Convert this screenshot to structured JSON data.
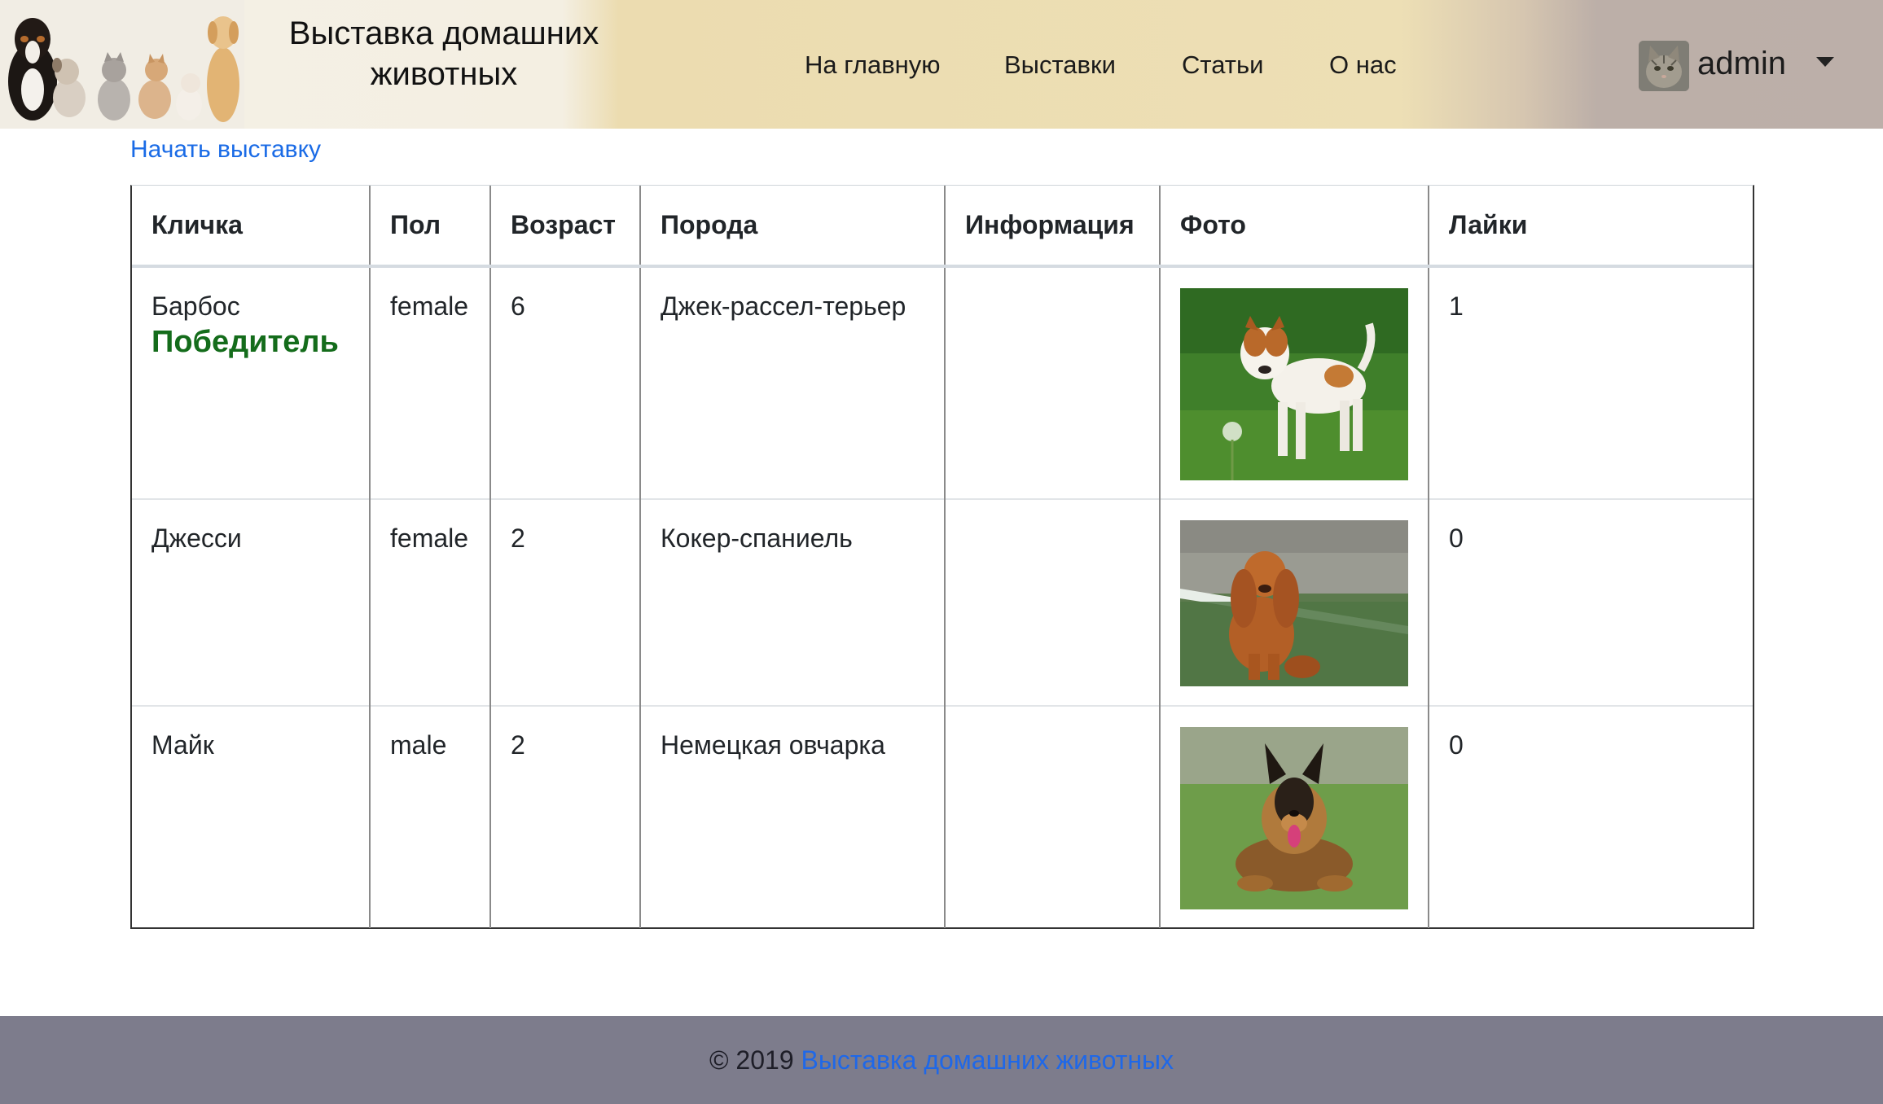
{
  "header": {
    "brand_title": "Выставка домашних животных",
    "nav": [
      {
        "label": "На главную"
      },
      {
        "label": "Выставки"
      },
      {
        "label": "Статьи"
      },
      {
        "label": "О нас"
      }
    ],
    "user": {
      "name": "admin"
    }
  },
  "main": {
    "start_link": "Начать выставку",
    "table": {
      "headers": [
        "Кличка",
        "Пол",
        "Возраст",
        "Порода",
        "Информация",
        "Фото",
        "Лайки"
      ],
      "rows": [
        {
          "name": "Барбос",
          "badge": "Победитель",
          "sex": "female",
          "age": "6",
          "breed": "Джек-рассел-терьер",
          "info": "",
          "likes": "1"
        },
        {
          "name": "Джесси",
          "badge": "",
          "sex": "female",
          "age": "2",
          "breed": "Кокер-спаниель",
          "info": "",
          "likes": "0"
        },
        {
          "name": "Майк",
          "badge": "",
          "sex": "male",
          "age": "2",
          "breed": "Немецкая овчарка",
          "info": "",
          "likes": "0"
        }
      ]
    }
  },
  "footer": {
    "copyright": "© 2019",
    "link": "Выставка домашних животных"
  },
  "colors": {
    "link": "#1a6be6",
    "winner": "#146c1b",
    "footer_bg": "#7d7c8c"
  }
}
